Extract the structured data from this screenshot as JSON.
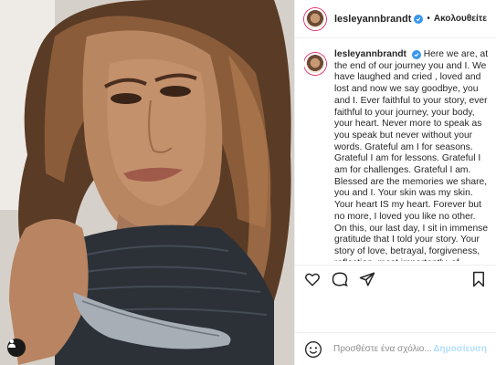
{
  "post": {
    "username": "lesleyannbrandt",
    "follow_label": "Ακολουθείτε",
    "separator": "•",
    "caption": "Here we are, at the end of our journey you and I. We have laughed and cried , loved and lost and now we say goodbye, you and I. Ever faithful to your story, ever faithful to your journey, your body, your heart. Never more to speak as you speak but never without your words. Grateful am I for seasons. Grateful I am for lessons. Grateful I am for challenges. Grateful I am. Blessed are the memories we share, you and I. Your skin was my skin. Your heart IS my heart. Forever but no more, I loved you like no other. On this, our last day, I sit in immense gratitude that I told your story. Your story of love, betrayal, forgiveness, reflection, most importantly, of LOVE. Never as close to another, but ready"
  },
  "comment_box": {
    "placeholder": "Προσθέστε ένα σχόλιο...",
    "post_label": "Δημοσίευση"
  },
  "icons": {
    "like": "heart-icon",
    "comment": "comment-icon",
    "share": "share-icon",
    "save": "bookmark-icon",
    "emoji": "smile-icon",
    "tag": "user-tag-icon"
  }
}
